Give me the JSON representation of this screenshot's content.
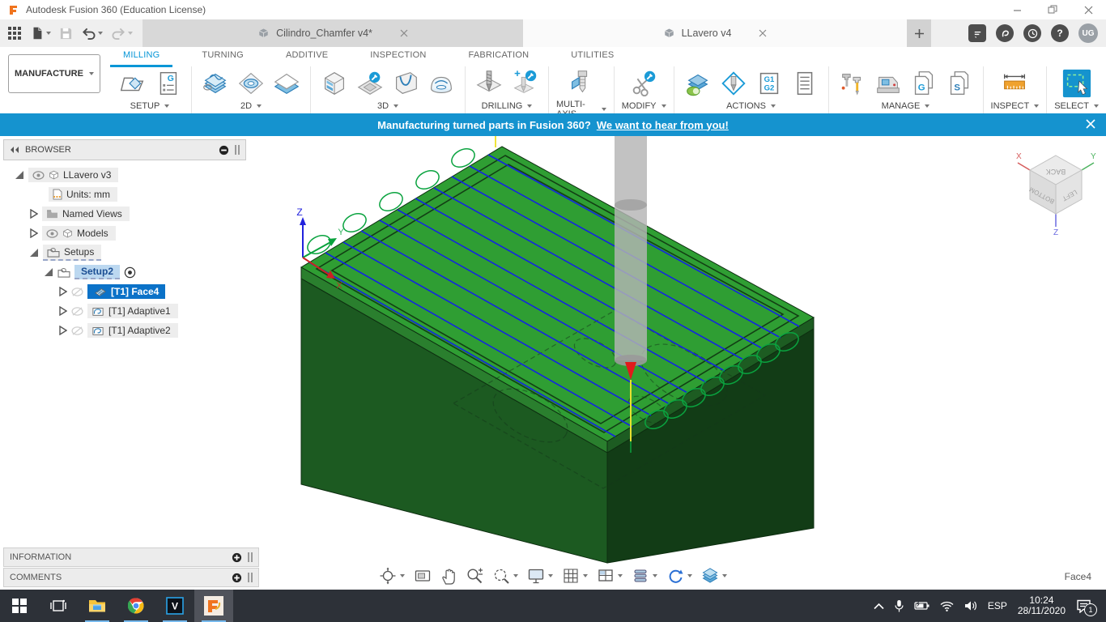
{
  "window": {
    "title": "Autodesk Fusion 360 (Education License)"
  },
  "tabbar": {
    "doc1": "Cilindro_Chamfer v4*",
    "doc2": "LLavero v4",
    "avatar": "UG",
    "help": "?"
  },
  "ribbon": {
    "workspace": "MANUFACTURE",
    "tabs": [
      {
        "label": "MILLING"
      },
      {
        "label": "TURNING"
      },
      {
        "label": "ADDITIVE"
      },
      {
        "label": "INSPECTION"
      },
      {
        "label": "FABRICATION"
      },
      {
        "label": "UTILITIES"
      }
    ],
    "groups": [
      {
        "label": "SETUP"
      },
      {
        "label": "2D"
      },
      {
        "label": "3D"
      },
      {
        "label": "DRILLING"
      },
      {
        "label": "MULTI-AXIS"
      },
      {
        "label": "MODIFY"
      },
      {
        "label": "ACTIONS"
      },
      {
        "label": "MANAGE"
      },
      {
        "label": "INSPECT"
      },
      {
        "label": "SELECT"
      }
    ],
    "icon_text": {
      "g": "G",
      "g1": "G1",
      "g2": "G2",
      "gfile": "G",
      "sfile": "S"
    }
  },
  "banner": {
    "text": "Manufacturing turned parts in Fusion 360?",
    "link": "We want to hear from you!"
  },
  "browser": {
    "title": "BROWSER",
    "items": [
      {
        "label": "LLavero v3"
      },
      {
        "label": "Units: mm"
      },
      {
        "label": "Named Views"
      },
      {
        "label": "Models"
      },
      {
        "label": "Setups"
      },
      {
        "label": "Setup2"
      },
      {
        "label": "[T1] Face4"
      },
      {
        "label": "[T1] Adaptive1"
      },
      {
        "label": "[T1] Adaptive2"
      }
    ]
  },
  "panels": {
    "information": "INFORMATION",
    "comments": "COMMENTS"
  },
  "viewport": {
    "status_hint": "Face4",
    "triad": {
      "x": "X",
      "y": "Y",
      "z": "Z"
    },
    "viewcube": {
      "top": "BACK",
      "left": "BOTTOM",
      "right": "LEFT",
      "x": "X",
      "y": "Y",
      "z": "Z"
    }
  },
  "taskbar": {
    "vsdc": "V",
    "language": "ESP",
    "time": "10:24",
    "date": "28/11/2020",
    "notification_count": "1"
  },
  "colors": {
    "accent_blue": "#0696D7",
    "banner_blue": "#1593CF",
    "selection_blue": "#0B72C8",
    "model_green": "#2F9E33",
    "toolpath_blue": "#1226E0",
    "lead_green": "#0AA33F"
  }
}
